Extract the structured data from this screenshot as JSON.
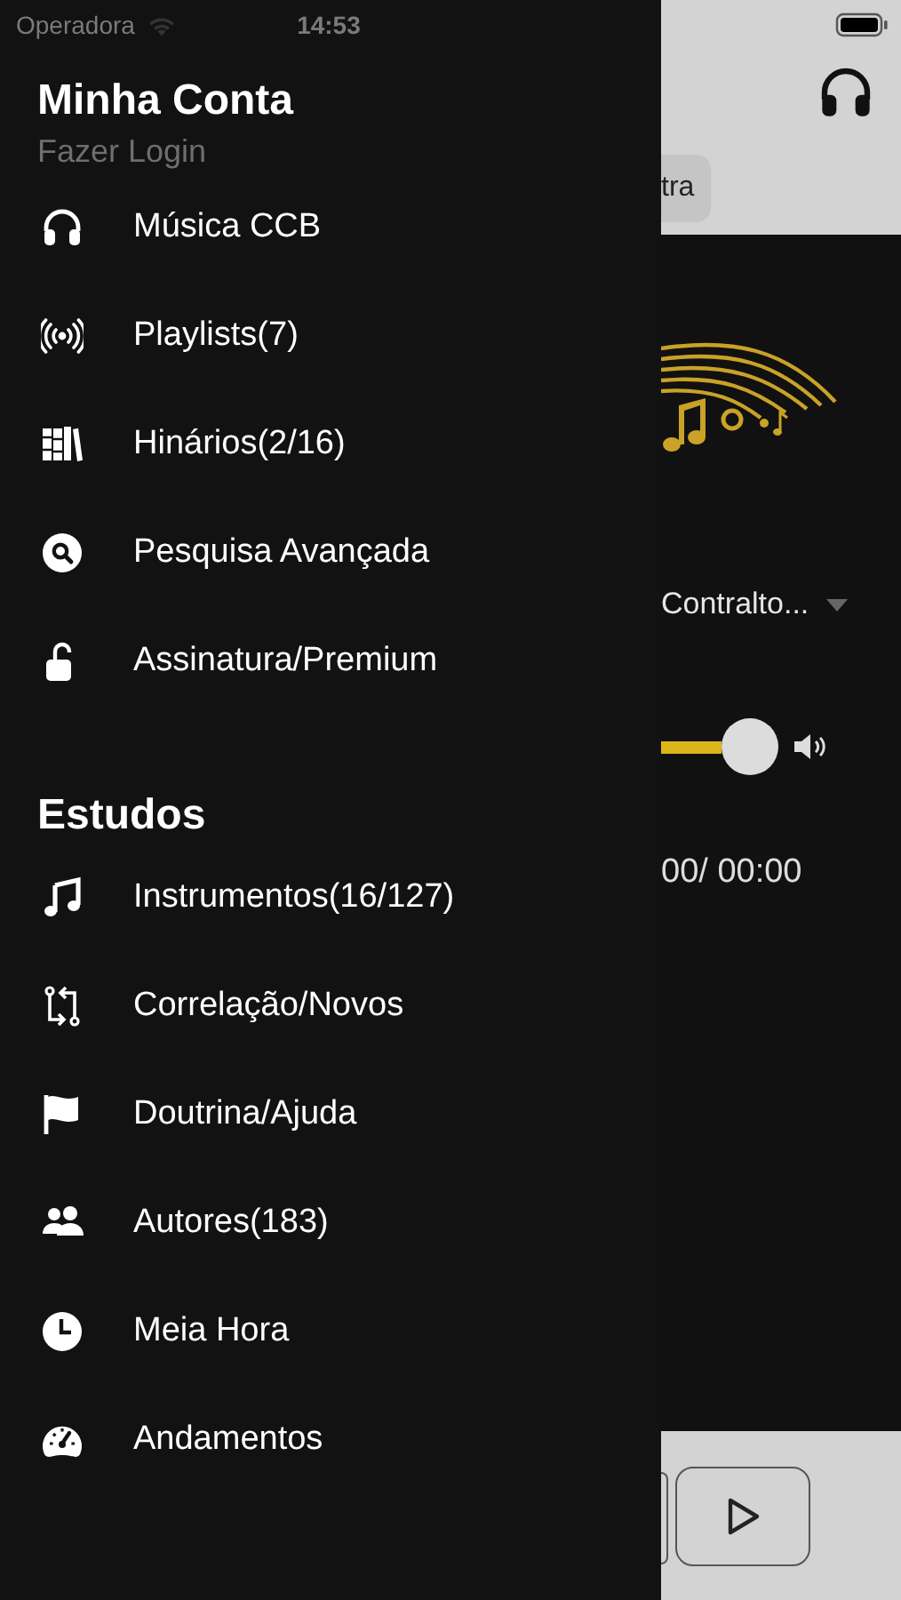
{
  "status_bar": {
    "carrier": "Operadora",
    "time": "14:53"
  },
  "drawer": {
    "title": "Minha Conta",
    "subtitle": "Fazer Login",
    "sections": [
      {
        "items": [
          {
            "label": "Música CCB"
          },
          {
            "label": "Playlists(7)"
          },
          {
            "label": "Hinários(2/16)"
          },
          {
            "label": "Pesquisa Avançada"
          },
          {
            "label": "Assinatura/Premium"
          }
        ]
      },
      {
        "heading": "Estudos",
        "items": [
          {
            "label": "Instrumentos(16/127)"
          },
          {
            "label": "Correlação/Novos"
          },
          {
            "label": "Doutrina/Ajuda"
          },
          {
            "label": "Autores(183)"
          },
          {
            "label": "Meia Hora"
          },
          {
            "label": "Andamentos"
          }
        ]
      }
    ]
  },
  "player": {
    "tab_label": "tra",
    "voice": "Contralto...",
    "time": "00/ 00:00"
  }
}
